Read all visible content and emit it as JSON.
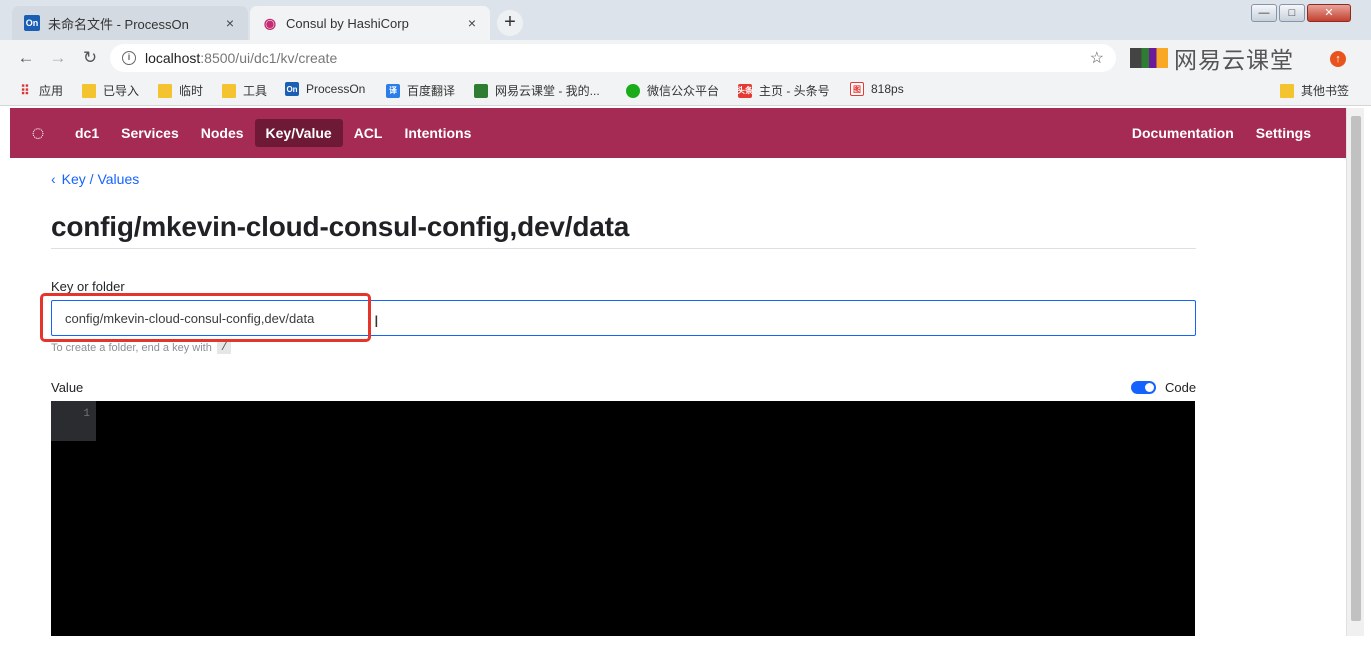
{
  "browser": {
    "tabs": [
      {
        "favicon": "On",
        "title": "未命名文件 - ProcessOn",
        "close": "×"
      },
      {
        "favicon": "consul-icon",
        "title": "Consul by HashiCorp",
        "close": "×"
      }
    ],
    "new_tab": "+",
    "window_controls": {
      "minimize": "—",
      "maximize": "□",
      "close": "✕"
    },
    "address": {
      "host": "localhost",
      "path": ":8500/ui/dc1/kv/create"
    },
    "brand_text": "网易云课堂",
    "bookmarks": [
      {
        "label": "应用",
        "icon": "apps-icon"
      },
      {
        "label": "已导入",
        "icon": "folder-icon"
      },
      {
        "label": "临时",
        "icon": "folder-icon"
      },
      {
        "label": "工具",
        "icon": "folder-icon"
      },
      {
        "label": "ProcessOn",
        "icon": "On"
      },
      {
        "label": "百度翻译",
        "icon": "译"
      },
      {
        "label": "网易云课堂 - 我的...",
        "icon": "netease-icon"
      },
      {
        "label": "微信公众平台",
        "icon": "wechat-icon"
      },
      {
        "label": "主页 - 头条号",
        "icon": "头条"
      },
      {
        "label": "818ps",
        "icon": "图"
      }
    ],
    "other_bookmarks": "其他书签"
  },
  "nav": {
    "datacenter": "dc1",
    "items": [
      {
        "label": "Services",
        "active": false
      },
      {
        "label": "Nodes",
        "active": false
      },
      {
        "label": "Key/Value",
        "active": true
      },
      {
        "label": "ACL",
        "active": false
      },
      {
        "label": "Intentions",
        "active": false
      }
    ],
    "right": [
      {
        "label": "Documentation"
      },
      {
        "label": "Settings"
      }
    ]
  },
  "breadcrumb": {
    "chevron": "‹",
    "label": "Key / Values"
  },
  "page_title": "config/mkevin-cloud-consul-config,dev/data",
  "form": {
    "key_label": "Key or folder",
    "key_value": "config/mkevin-cloud-consul-config,dev/data",
    "key_help": "To create a folder, end a key with",
    "key_help_code": "/",
    "value_label": "Value",
    "code_toggle_label": "Code",
    "code_toggle_on": true,
    "line_numbers": [
      "1"
    ]
  },
  "colors": {
    "nav_bg": "#a52b55",
    "nav_active": "#6e1a37",
    "link": "#1563ff",
    "annotation_box": "#e5342c"
  }
}
